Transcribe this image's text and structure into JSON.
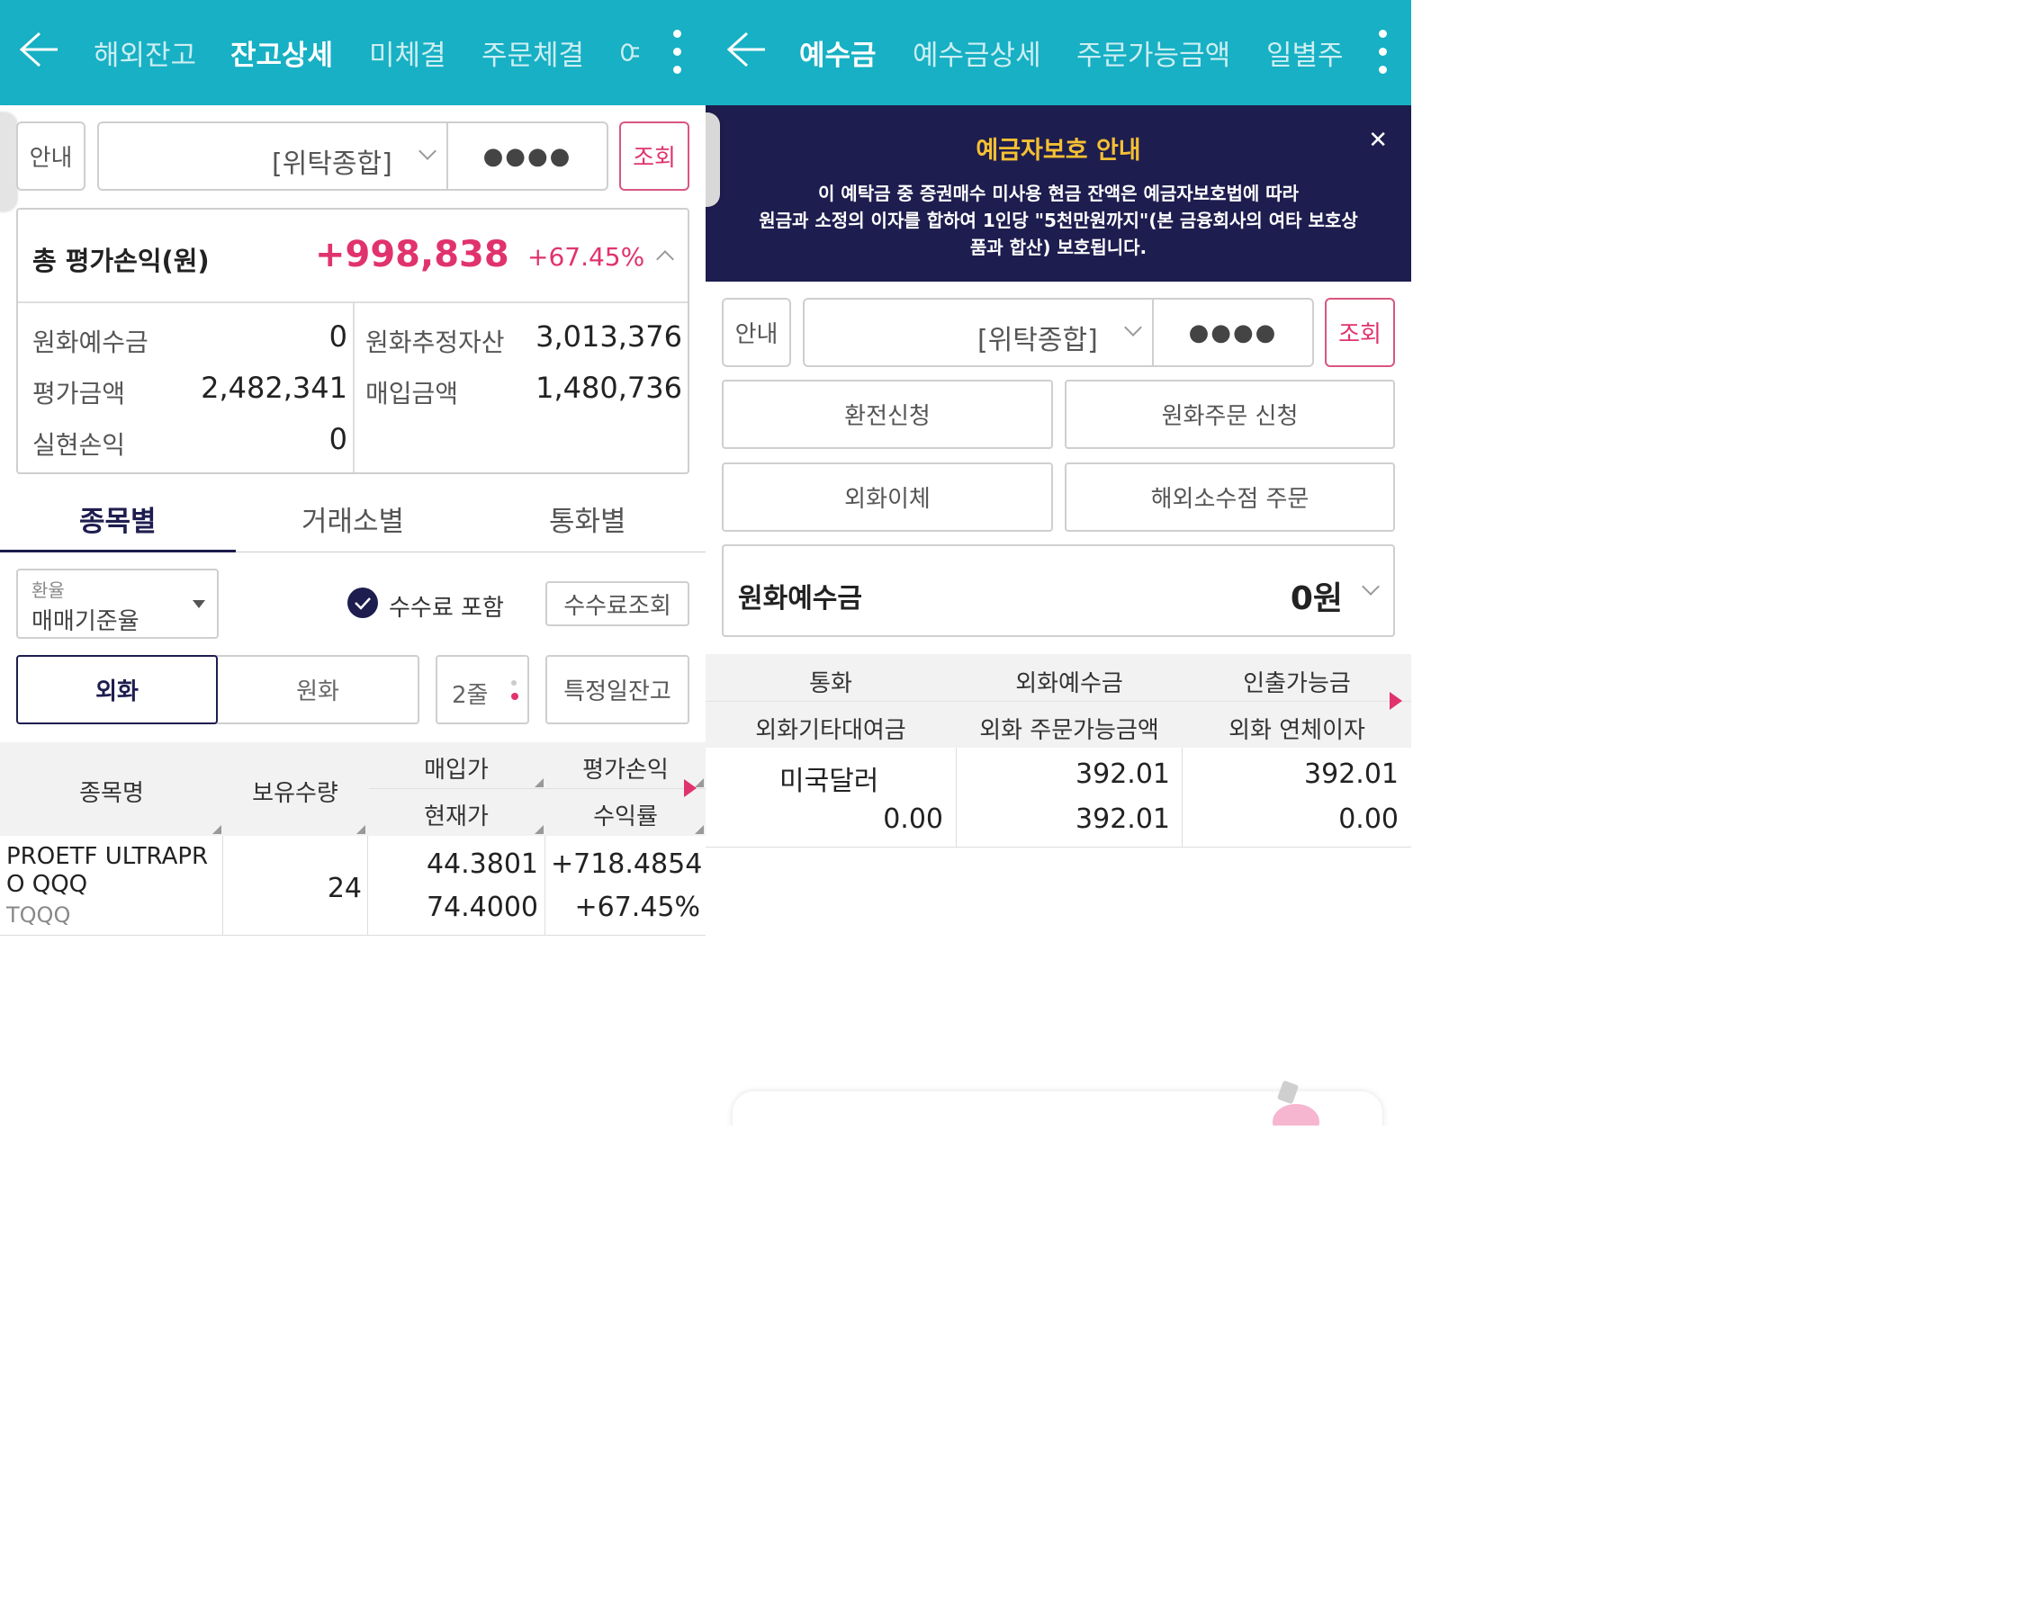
{
  "left": {
    "nav": {
      "tabs": [
        "해외잔고",
        "잔고상세",
        "미체결",
        "주문체결",
        "여"
      ],
      "active_index": 1
    },
    "account": {
      "info_label": "안내",
      "account_type": "[위탁종합]",
      "password_mask": "●●●●",
      "query_label": "조회"
    },
    "summary": {
      "title": "총 평가손익(원)",
      "profit": "+998,838",
      "rate": "+67.45%",
      "rows": [
        {
          "label": "원화예수금",
          "value": "0"
        },
        {
          "label": "원화추정자산",
          "value": "3,013,376"
        },
        {
          "label": "평가금액",
          "value": "2,482,341"
        },
        {
          "label": "매입금액",
          "value": "1,480,736"
        },
        {
          "label": "실현손익",
          "value": "0"
        }
      ]
    },
    "view_tabs": [
      "종목별",
      "거래소별",
      "통화별"
    ],
    "exchange_rate": {
      "label": "환율",
      "value": "매매기준율"
    },
    "fee_include_label": "수수료 포함",
    "fee_query_label": "수수료조회",
    "currency_toggle": [
      "외화",
      "원화"
    ],
    "row_mode": "2줄",
    "specific_date_label": "특정일잔고",
    "table": {
      "headers": {
        "name": "종목명",
        "qty": "보유수량",
        "buy_price": "매입가",
        "cur_price": "현재가",
        "pnl": "평가손익",
        "ret": "수익률"
      },
      "rows": [
        {
          "name_line1": "PROETF ULTRAPR",
          "name_line2": "O QQQ",
          "ticker": "TQQQ",
          "qty": "24",
          "buy_price": "44.3801",
          "cur_price": "74.4000",
          "pnl": "+718.4854",
          "ret": "+67.45%"
        }
      ]
    }
  },
  "right": {
    "nav": {
      "tabs": [
        "예수금",
        "예수금상세",
        "주문가능금액",
        "일별주"
      ],
      "active_index": 0
    },
    "notice": {
      "title": "예금자보호 안내",
      "line1": "이 예탁금 중 증권매수 미사용 현금 잔액은 예금자보호법에 따라",
      "line2": "원금과 소정의 이자를 합하여 1인당 \"5천만원까지\"(본 금융회사의 여타 보호상",
      "line3": "품과 합산) 보호됩니다.",
      "close_glyph": "✕"
    },
    "account": {
      "info_label": "안내",
      "account_type": "[위탁종합]",
      "password_mask": "●●●●",
      "query_label": "조회"
    },
    "actions": [
      "환전신청",
      "원화주문 신청",
      "외화이체",
      "해외소수점 주문"
    ],
    "krw_deposit": {
      "label": "원화예수금",
      "value": "0원"
    },
    "table": {
      "headers": [
        "통화",
        "외화예수금",
        "인출가능금",
        "외화기타대여금",
        "외화 주문가능금액",
        "외화 연체이자"
      ],
      "rows": [
        {
          "currency": "미국달러",
          "other_loan": "0.00",
          "deposit": "392.01",
          "orderable": "392.01",
          "withdrawable": "392.01",
          "overdue": "0.00"
        }
      ]
    }
  },
  "colors": {
    "teal": "#17b0c4",
    "navy": "#1e1d4f",
    "pink": "#e0336e",
    "gold": "#f5c033"
  }
}
